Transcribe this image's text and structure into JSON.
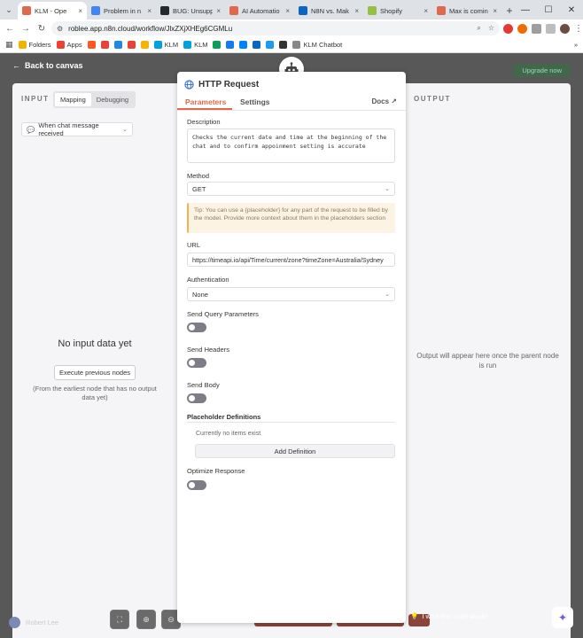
{
  "browser": {
    "tabs": [
      {
        "title": "KLM - Ope",
        "color": "#e0694b",
        "active": true
      },
      {
        "title": "Problem in n",
        "color": "#4285f4",
        "active": false
      },
      {
        "title": "BUG: Unsupp",
        "color": "#24292e",
        "active": false
      },
      {
        "title": "AI Automatio",
        "color": "#e0694b",
        "active": false
      },
      {
        "title": "N8N vs. Mak",
        "color": "#0a66c2",
        "active": false
      },
      {
        "title": "Shopify",
        "color": "#95bf47",
        "active": false
      },
      {
        "title": "Max is comin",
        "color": "#e0694b",
        "active": false
      }
    ],
    "new_tab": "+",
    "url": "roblee.app.n8n.cloud/workflow/JlxZXjXHEg6CGMLu",
    "bookmarks": [
      {
        "label": "Folders",
        "color": "#f0b400"
      },
      {
        "label": "Apps",
        "color": "#ea4335"
      },
      {
        "label": "",
        "color": "#ff5722"
      },
      {
        "label": "",
        "color": "#ea4335"
      },
      {
        "label": "",
        "color": "#1e88e5"
      },
      {
        "label": "",
        "color": "#ea4335"
      },
      {
        "label": "",
        "color": "#f4b400"
      },
      {
        "label": "KLM",
        "color": "#00a1de"
      },
      {
        "label": "KLM",
        "color": "#00a1de"
      },
      {
        "label": "",
        "color": "#0f9d58"
      },
      {
        "label": "",
        "color": "#1877f2"
      },
      {
        "label": "",
        "color": "#0081fb"
      },
      {
        "label": "",
        "color": "#0a66c2"
      },
      {
        "label": "",
        "color": "#1d9bf0"
      },
      {
        "label": "",
        "color": "#333333"
      },
      {
        "label": "KLM Chatbot",
        "color": "#888888"
      }
    ],
    "bookmarks_more": "»"
  },
  "topbar": {
    "back_label": "Back to canvas",
    "upgrade_label": "Upgrade now"
  },
  "input_pane": {
    "title": "INPUT",
    "mode_mapping": "Mapping",
    "mode_debugging": "Debugging",
    "trigger": "When chat message received",
    "empty_title": "No input data yet",
    "execute_label": "Execute previous nodes",
    "hint": "(From the earliest node that has no output data yet)"
  },
  "output_pane": {
    "title": "OUTPUT",
    "message": "Output will appear here once the parent node is run"
  },
  "node": {
    "title": "HTTP Request",
    "tab_parameters": "Parameters",
    "tab_settings": "Settings",
    "docs_label": "Docs",
    "description_label": "Description",
    "description_value": "Checks the current date and time at the beginning of the chat and to confirm appoinment setting is accurate",
    "method_label": "Method",
    "method_value": "GET",
    "tip": "Tip: You can use a {placeholder} for any part of the request to be filled by the model. Provide more context about them in the placeholders section",
    "url_label": "URL",
    "url_value": "https://timeapi.io/api/Time/current/zone?timeZone=Australia/Sydney",
    "auth_label": "Authentication",
    "auth_value": "None",
    "send_query_label": "Send Query Parameters",
    "send_headers_label": "Send Headers",
    "send_body_label": "Send Body",
    "placeholder_defs_label": "Placeholder Definitions",
    "no_items": "Currently no items exist",
    "add_definition": "Add Definition",
    "optimize_label": "Optimize Response"
  },
  "footer": {
    "user_name": "Robert Lee",
    "wish_label": "I wish this node would..."
  },
  "colors": {
    "accent": "#e0694b",
    "toggle_off": "#7d7d87",
    "tip_bg": "#fdf3e3"
  }
}
